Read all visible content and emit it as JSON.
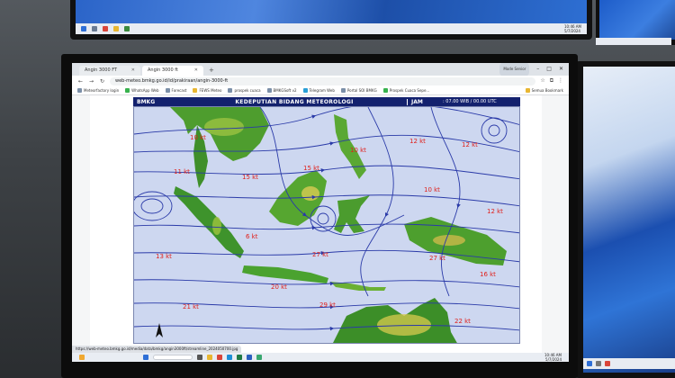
{
  "browser": {
    "tabs": [
      {
        "label": "Angin 3000 FT",
        "active": false
      },
      {
        "label": "Angin 3000 ft",
        "active": true
      }
    ],
    "new_tab": "+",
    "profile": "Mode Senior",
    "address": "web-meteo.bmkg.go.id/id/prakiraan/angin-3000-ft",
    "status_url": "https://web-meteo.bmkg.go.id/media/data/bmkg/angin3000ft/streamline_2024050700.jpg",
    "bookmarks": [
      "Meteorfactory login",
      "WhatsApp Web",
      "Forecast",
      "FEWS Meteo",
      "prospek cuaca",
      "BMKGSoft v2",
      "Telegram Web",
      "Portal SOI BMKG",
      "Prospek Cuaca Sepe..."
    ],
    "all_bookmarks": "Semua Bookmark"
  },
  "map": {
    "agency": "BMKG",
    "title": "KEDEPUTIAN BIDANG METEOROLOGI",
    "jam_label": "JAM",
    "time": ": 07.00 WIB / 00.00 UTC",
    "wind_labels": [
      {
        "text": "10 kt",
        "id": "w1"
      },
      {
        "text": "11 kt",
        "id": "w2"
      },
      {
        "text": "15 kt",
        "id": "w3"
      },
      {
        "text": "15 kt",
        "id": "w4"
      },
      {
        "text": "10 kt",
        "id": "w5"
      },
      {
        "text": "12 kt",
        "id": "w6"
      },
      {
        "text": "12 kt",
        "id": "w7"
      },
      {
        "text": "10 kt",
        "id": "w8"
      },
      {
        "text": "6 kt",
        "id": "w9"
      },
      {
        "text": "12 kt",
        "id": "w10"
      },
      {
        "text": "27 kt",
        "id": "w11"
      },
      {
        "text": "20 kt",
        "id": "w12"
      },
      {
        "text": "13 kt",
        "id": "w13"
      },
      {
        "text": "21 kt",
        "id": "w14"
      },
      {
        "text": "29 kt",
        "id": "w15"
      },
      {
        "text": "27 kt",
        "id": "w16"
      },
      {
        "text": "16 kt",
        "id": "w17"
      },
      {
        "text": "22 kt",
        "id": "w18"
      }
    ],
    "colors": {
      "sea": "#cdd7f0",
      "streamline": "#2a3aa8",
      "land_low": "#1f7a2a",
      "land_mid": "#6fb52e",
      "land_high": "#e6d35a",
      "label": "#e0201b"
    }
  },
  "taskbar": {
    "time": "10:46 AM",
    "date": "5/7/2024"
  }
}
